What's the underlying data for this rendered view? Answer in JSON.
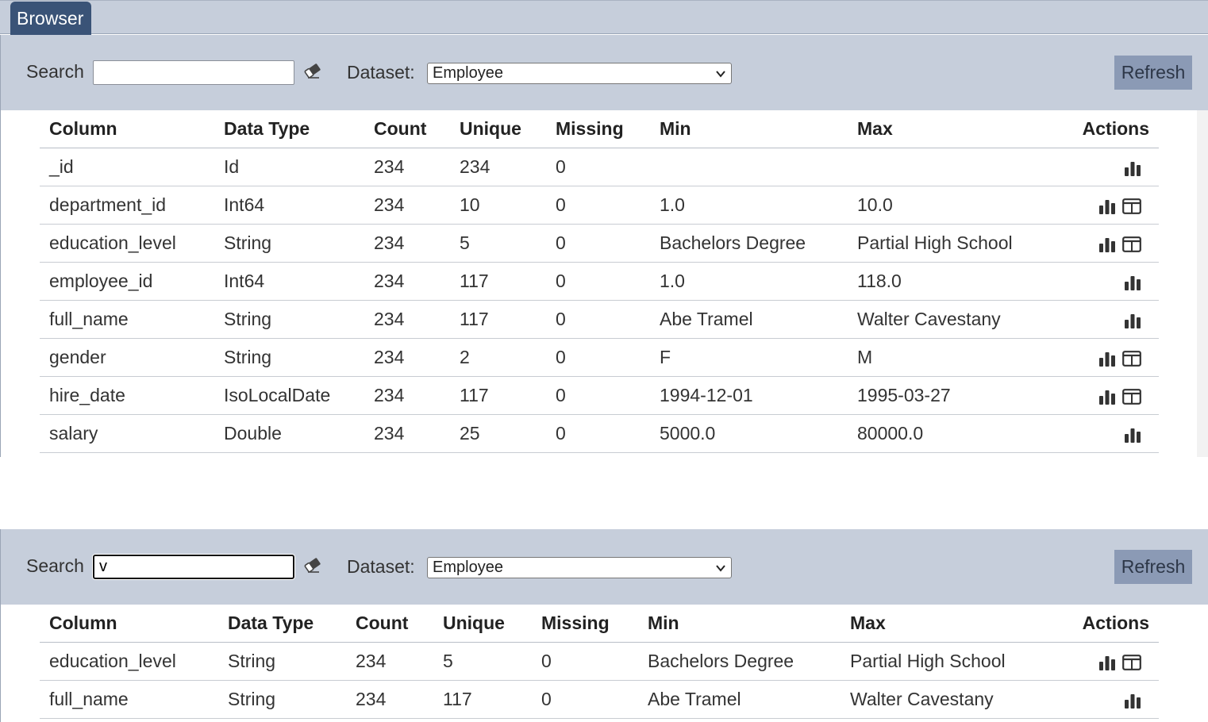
{
  "tab": {
    "label": "Browser"
  },
  "colors": {
    "toolbar_bg": "#c6cedb",
    "tab_bg": "#3a5377",
    "refresh_bg": "#8b9ab5"
  },
  "panels": [
    {
      "search": {
        "label": "Search",
        "value": ""
      },
      "dataset": {
        "label": "Dataset:",
        "value": "Employee"
      },
      "refresh_label": "Refresh",
      "table": {
        "headers": [
          "Column",
          "Data Type",
          "Count",
          "Unique",
          "Missing",
          "Min",
          "Max",
          "Actions"
        ],
        "rows": [
          {
            "column": "_id",
            "type": "Id",
            "count": "234",
            "unique": "234",
            "missing": "0",
            "min": "",
            "max": "",
            "actions": [
              "chart-icon"
            ]
          },
          {
            "column": "department_id",
            "type": "Int64",
            "count": "234",
            "unique": "10",
            "missing": "0",
            "min": "1.0",
            "max": "10.0",
            "actions": [
              "chart-icon",
              "table-icon"
            ]
          },
          {
            "column": "education_level",
            "type": "String",
            "count": "234",
            "unique": "5",
            "missing": "0",
            "min": "Bachelors Degree",
            "max": "Partial High School",
            "actions": [
              "chart-icon",
              "table-icon"
            ]
          },
          {
            "column": "employee_id",
            "type": "Int64",
            "count": "234",
            "unique": "117",
            "missing": "0",
            "min": "1.0",
            "max": "118.0",
            "actions": [
              "chart-icon"
            ]
          },
          {
            "column": "full_name",
            "type": "String",
            "count": "234",
            "unique": "117",
            "missing": "0",
            "min": "Abe Tramel",
            "max": "Walter Cavestany",
            "actions": [
              "chart-icon"
            ]
          },
          {
            "column": "gender",
            "type": "String",
            "count": "234",
            "unique": "2",
            "missing": "0",
            "min": "F",
            "max": "M",
            "actions": [
              "chart-icon",
              "table-icon"
            ]
          },
          {
            "column": "hire_date",
            "type": "IsoLocalDate",
            "count": "234",
            "unique": "117",
            "missing": "0",
            "min": "1994-12-01",
            "max": "1995-03-27",
            "actions": [
              "chart-icon",
              "table-icon"
            ]
          },
          {
            "column": "salary",
            "type": "Double",
            "count": "234",
            "unique": "25",
            "missing": "0",
            "min": "5000.0",
            "max": "80000.0",
            "actions": [
              "chart-icon"
            ]
          }
        ]
      }
    },
    {
      "search": {
        "label": "Search",
        "value": "v"
      },
      "dataset": {
        "label": "Dataset:",
        "value": "Employee"
      },
      "refresh_label": "Refresh",
      "table": {
        "headers": [
          "Column",
          "Data Type",
          "Count",
          "Unique",
          "Missing",
          "Min",
          "Max",
          "Actions"
        ],
        "rows": [
          {
            "column": "education_level",
            "type": "String",
            "count": "234",
            "unique": "5",
            "missing": "0",
            "min": "Bachelors Degree",
            "max": "Partial High School",
            "actions": [
              "chart-icon",
              "table-icon"
            ]
          },
          {
            "column": "full_name",
            "type": "String",
            "count": "234",
            "unique": "117",
            "missing": "0",
            "min": "Abe Tramel",
            "max": "Walter Cavestany",
            "actions": [
              "chart-icon"
            ]
          }
        ]
      }
    }
  ]
}
